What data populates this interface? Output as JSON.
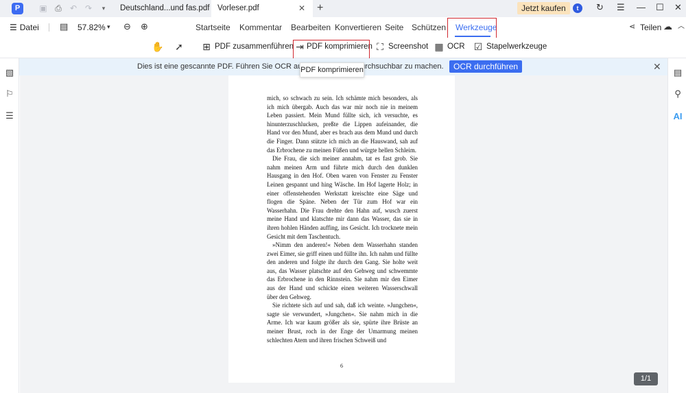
{
  "tabs": [
    {
      "label": "Deutschland...und fas.pdf"
    },
    {
      "label": "Vorleser.pdf"
    }
  ],
  "topbar": {
    "buy_label": "Jetzt kaufen",
    "avatar_letter": "t"
  },
  "menubar": {
    "file_label": "Datei",
    "zoom": "57.82%",
    "items": [
      "Startseite",
      "Kommentar",
      "Bearbeiten",
      "Konvertieren",
      "Seite",
      "Schützen",
      "Werkzeuge"
    ],
    "share_label": "Teilen"
  },
  "ribbon": {
    "items": [
      "PDF zusammenführen",
      "PDF komprimieren",
      "Screenshot",
      "OCR",
      "Stapelwerkzeuge"
    ]
  },
  "banner": {
    "text": "Dies ist eine gescannte PDF. Führen Sie OCR aus, um",
    "text_end": "durchsuchbar zu machen.",
    "ocr_button": "OCR durchführen"
  },
  "tooltip": "PDF komprimieren",
  "document": {
    "paragraphs": [
      "mich, so schwach zu sein. Ich schämte mich besonders, als ich mich übergab. Auch das war mir noch nie in meinem Leben passiert. Mein Mund füllte sich, ich versuchte, es hinunterzuschlucken, preßte die Lippen aufeinander, die Hand vor den Mund, aber es brach aus dem Mund und durch die Finger. Dann stützte ich mich an die Hauswand, sah auf das Erbrochene zu meinen Füßen und würgte hellen Schleim.",
      "Die Frau, die sich meiner annahm, tat es fast grob. Sie nahm meinen Arm und führte mich durch den dunklen Hausgang in den Hof. Oben waren von Fenster zu Fenster Leinen gespannt und hing Wäsche. Im Hof lagerte Holz; in einer offenstehenden Werkstatt kreischte eine Säge und flogen die Späne. Neben der Tür zum Hof war ein Wasserhahn. Die Frau drehte den Hahn auf, wusch zuerst meine Hand und klatschte mir dann das Wasser, das sie in ihren hohlen Händen auffing, ins Gesicht. Ich trocknete mein Gesicht mit dem Taschentuch.",
      "»Nimm den anderen!« Neben dem Wasserhahn standen zwei Eimer, sie griff einen und füllte ihn. Ich nahm und füllte den anderen und folgte ihr durch den Gang. Sie holte weit aus, das Wasser platschte auf den Gehweg und schwemmte das Erbrochene in den Rinnstein. Sie nahm mir den Eimer aus der Hand und schickte einen weiteren Wasserschwall über den Gehweg.",
      "Sie richtete sich auf und sah, daß ich weinte. »Jungchen«, sagte sie verwundert, »Jungchen«. Sie nahm mich in die Arme. Ich war kaum größer als sie, spürte ihre Brüste an meiner Brust, roch in der Enge der Umarmung meinen schlechten Atem und ihren frischen Schweiß und"
    ],
    "page_number": "6",
    "page_indicator": "1/1"
  },
  "colors": {
    "accent": "#3b6df0",
    "highlight": "#d0272f",
    "banner_bg": "#e8f2fb",
    "buy_bg": "#fbe3bc"
  }
}
